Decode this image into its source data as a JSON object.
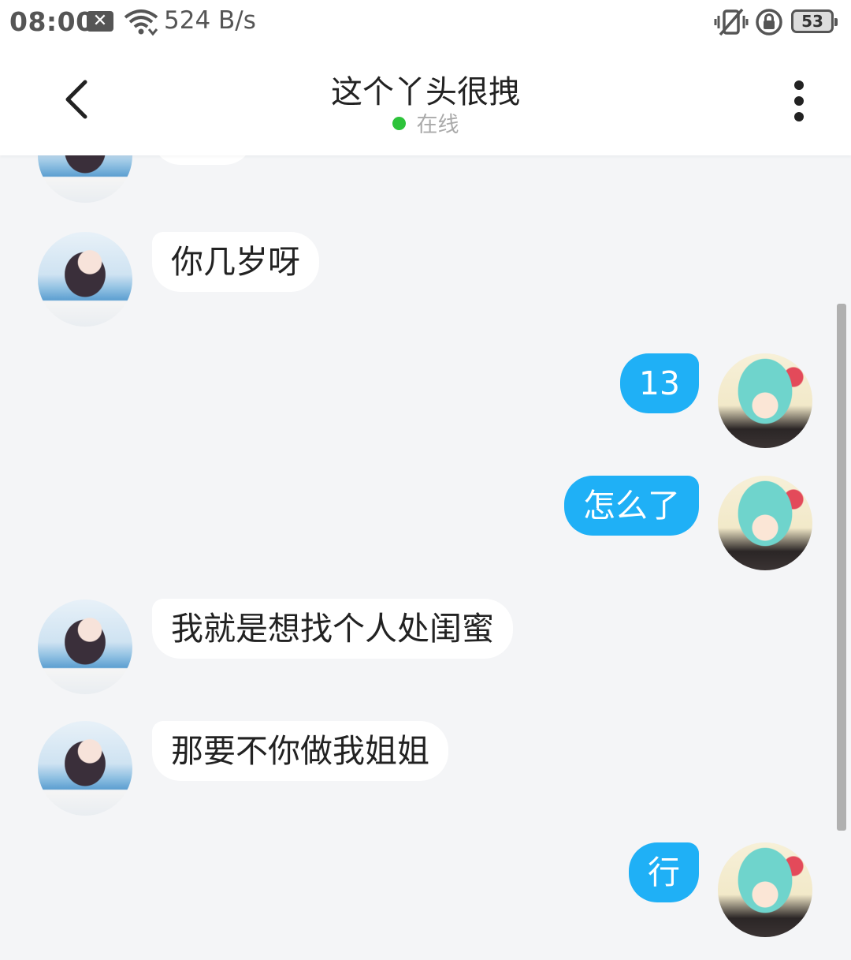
{
  "status_bar": {
    "time": "08:00",
    "close_glyph": "✕",
    "net_speed": "524 B/s",
    "battery": "53",
    "icons": [
      "wifi-icon",
      "vibrate-off-icon",
      "lock-rotation-icon",
      "battery-icon"
    ]
  },
  "header": {
    "title": "这个丫头很拽",
    "status": "在线",
    "status_color": "#2dc33a",
    "back_icon": "chevron-left-icon",
    "more_icon": "more-vertical-icon"
  },
  "messages": [
    {
      "from": "them",
      "text": "你几岁呀"
    },
    {
      "from": "me",
      "text": "13"
    },
    {
      "from": "me",
      "text": "怎么了"
    },
    {
      "from": "them",
      "text": "我就是想找个人处闺蜜"
    },
    {
      "from": "them",
      "text": "那要不你做我姐姐"
    },
    {
      "from": "me",
      "text": "行"
    }
  ],
  "colors": {
    "outgoing_bubble": "#1fb0f6",
    "incoming_bubble": "#ffffff",
    "background": "#f4f5f7"
  }
}
